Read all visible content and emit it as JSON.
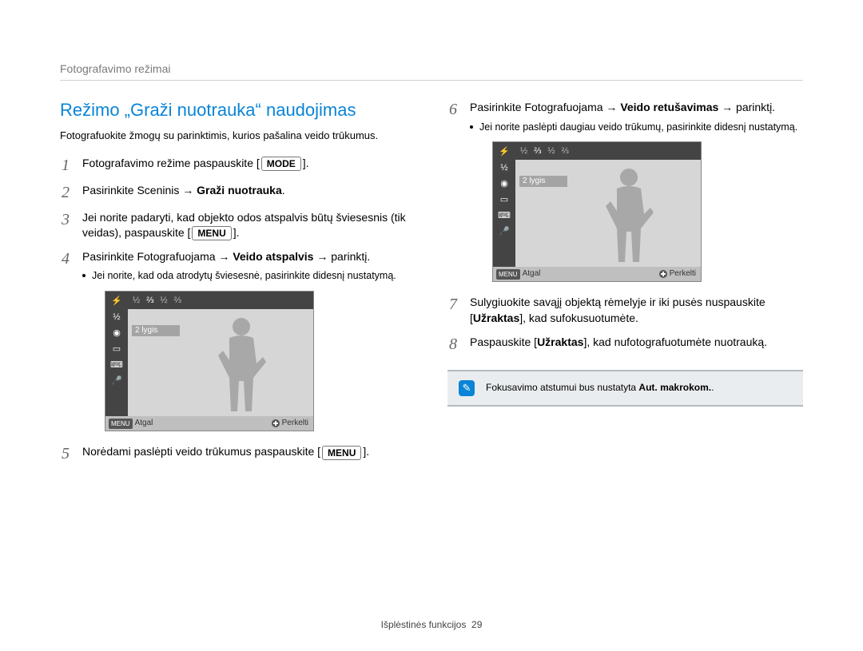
{
  "header": "Fotografavimo režimai",
  "title": "Režimo „Graži nuotrauka“ naudojimas",
  "intro": "Fotografuokite žmogų su parinktimis, kurios pašalina veido trūkumus.",
  "mode_btn": "MODE",
  "menu_btn": "MENU",
  "step1a": "Fotografavimo režime paspauskite ",
  "step1b": ".",
  "step2a": "Pasirinkite Sceninis → ",
  "step2b": "Graži nuotrauka",
  "step2c": ".",
  "step3a": "Jei norite padaryti, kad objekto odos atspalvis būtų šviesesnis (tik veidas), paspauskite ",
  "step3b": ".",
  "step4a": "Pasirinkite Fotografuojama → ",
  "step4b": "Veido atspalvis",
  "step4c": " → parinktį.",
  "bullet4": "Jei norite, kad oda atrodytų šviesesnė, pasirinkite didesnį nustatymą.",
  "step5a": "Norėdami paslėpti veido trūkumus paspauskite ",
  "step5b": ".",
  "step6a": "Pasirinkite Fotografuojama → ",
  "step6b": "Veido retušavimas",
  "step6c": " → parinktį.",
  "bullet6": "Jei norite paslėpti daugiau veido trūkumų, pasirinkite didesnį nustatymą.",
  "step7a": "Sulygiuokite savąjį objektą rėmelyje ir iki pusės nuspauskite [",
  "step7b": "Užraktas",
  "step7c": "], kad sufokusuotumėte.",
  "step8a": "Paspauskite [",
  "step8b": "Užraktas",
  "step8c": "], kad nufotografuotumėte nuotrauką.",
  "note_text_a": "Fokusavimo atstumui bus nustatyta ",
  "note_text_b": "Aut. makrokom.",
  "note_text_c": ".",
  "note_badge": "✎",
  "footer_label": "Išplėstinės funkcijos",
  "footer_page": "29",
  "lcd": {
    "fracs": [
      "½",
      "⅔",
      "½",
      "⅔"
    ],
    "active_idx": 1,
    "tooltip": "2 lygis",
    "menu_label": "MENU",
    "back_label": "Atgal",
    "move_label": "Perkelti"
  }
}
